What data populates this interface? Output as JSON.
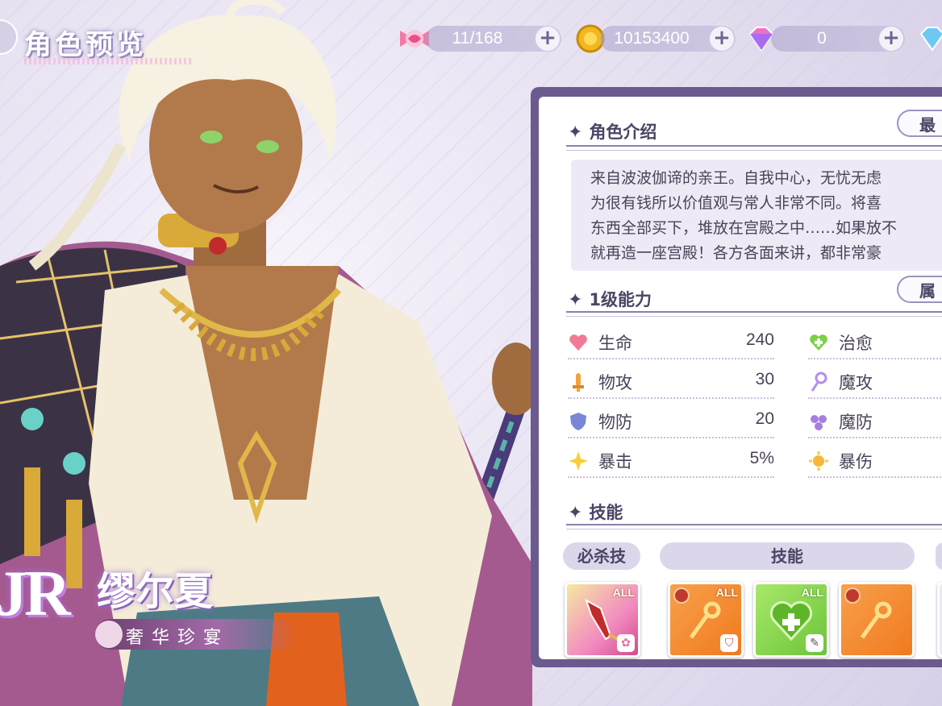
{
  "page_title": "角色预览",
  "resources": [
    {
      "icon": "candy-icon",
      "value": "11/168",
      "plus": "+"
    },
    {
      "icon": "gold-coin-icon",
      "value": "10153400",
      "plus": "+"
    },
    {
      "icon": "diamond-icon",
      "value": "0",
      "plus": "+"
    }
  ],
  "character": {
    "rarity": "JR",
    "name": "缪尔夏",
    "subtitle": "奢华珍宴"
  },
  "intro": {
    "heading": "角色介绍",
    "side_button": "最",
    "description": "来自波波伽谛的亲王。自我中心，无忧无虑\n为很有钱所以价值观与常人非常不同。将喜\n东西全部买下，堆放在宫殿之中……如果放不\n就再造一座宫殿！各方各面来讲，都非常豪"
  },
  "abilities": {
    "heading": "1级能力",
    "side_button": "属",
    "left": [
      {
        "icon": "heart-icon",
        "label": "生命",
        "value": "240"
      },
      {
        "icon": "sword-icon",
        "label": "物攻",
        "value": "30"
      },
      {
        "icon": "shield-icon",
        "label": "物防",
        "value": "20"
      },
      {
        "icon": "crit-star-icon",
        "label": "暴击",
        "value": "5%"
      }
    ],
    "right": [
      {
        "icon": "heal-heart-icon",
        "label": "治愈"
      },
      {
        "icon": "magic-staff-icon",
        "label": "魔攻"
      },
      {
        "icon": "magic-defense-icon",
        "label": "魔防"
      },
      {
        "icon": "crit-damage-icon",
        "label": "暴伤"
      }
    ]
  },
  "skills": {
    "heading": "技能",
    "tabs": {
      "ultimate": "必杀技",
      "skill": "技能"
    },
    "badge": "ALL",
    "items": [
      {
        "icon": "crystal-spear-skill-icon"
      },
      {
        "icon": "golden-staff-skill-icon"
      },
      {
        "icon": "heal-plus-skill-icon"
      },
      {
        "icon": "golden-staff-skill-icon"
      }
    ]
  },
  "colors": {
    "panel_border": "#6a5a8e",
    "accent_purple": "#4c4464",
    "skill_orange": "#f08a2a",
    "skill_green": "#7ccf48",
    "skill_pink": "#e46fa8"
  }
}
